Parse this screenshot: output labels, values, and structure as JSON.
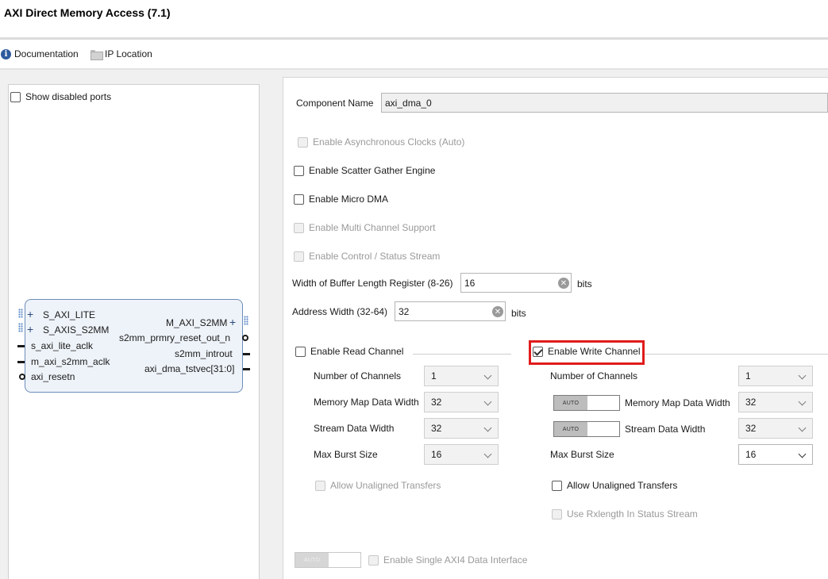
{
  "window": {
    "title": "AXI Direct Memory Access (7.1)"
  },
  "toolbar": {
    "documentation_label": "Documentation",
    "documentation_icon": "info-icon",
    "ip_location_label": "IP Location",
    "ip_location_icon": "folder-icon"
  },
  "symbol_panel": {
    "show_disabled_ports_label": "Show disabled ports",
    "show_disabled_ports_checked": false,
    "block": {
      "left_ports": [
        "S_AXI_LITE",
        "S_AXIS_S2MM",
        "s_axi_lite_aclk",
        "m_axi_s2mm_aclk",
        "axi_resetn"
      ],
      "right_ports": [
        "M_AXI_S2MM",
        "s2mm_prmry_reset_out_n",
        "s2mm_introut",
        "axi_dma_tstvec[31:0]"
      ]
    }
  },
  "config": {
    "component_name_label": "Component Name",
    "component_name_value": "axi_dma_0",
    "enable_async_clocks": "Enable Asynchronous Clocks (Auto)",
    "enable_scatter_gather": "Enable Scatter Gather Engine",
    "enable_micro_dma": "Enable Micro DMA",
    "enable_multi_channel": "Enable Multi Channel Support",
    "enable_control_status": "Enable Control / Status Stream",
    "buffer_length_label": "Width of Buffer Length Register (8-26)",
    "buffer_length_value": "16",
    "buffer_length_unit": "bits",
    "address_width_label": "Address Width (32-64)",
    "address_width_value": "32",
    "address_width_unit": "bits",
    "read_channel": {
      "enable_label": "Enable Read Channel",
      "enabled": false,
      "num_channels_label": "Number of Channels",
      "num_channels_value": "1",
      "mm_data_width_label": "Memory Map Data Width",
      "mm_data_width_value": "32",
      "stream_data_width_label": "Stream Data Width",
      "stream_data_width_value": "32",
      "max_burst_label": "Max Burst Size",
      "max_burst_value": "16",
      "unaligned_label": "Allow Unaligned Transfers"
    },
    "write_channel": {
      "enable_label": "Enable Write Channel",
      "enabled": true,
      "num_channels_label": "Number of Channels",
      "num_channels_value": "1",
      "auto_label": "AUTO",
      "mm_data_width_label": "Memory Map Data Width",
      "mm_data_width_value": "32",
      "stream_data_width_label": "Stream Data Width",
      "stream_data_width_value": "32",
      "max_burst_label": "Max Burst Size",
      "max_burst_value": "16",
      "unaligned_label": "Allow Unaligned Transfers",
      "rxlength_label": "Use Rxlength In Status Stream"
    },
    "single_axi4_label": "Enable Single AXI4 Data Interface",
    "single_axi4_auto": "AUTO"
  },
  "colors": {
    "highlight": "#e01c1c",
    "block_border": "#6b8db8",
    "block_fill": "#eef3f9"
  }
}
